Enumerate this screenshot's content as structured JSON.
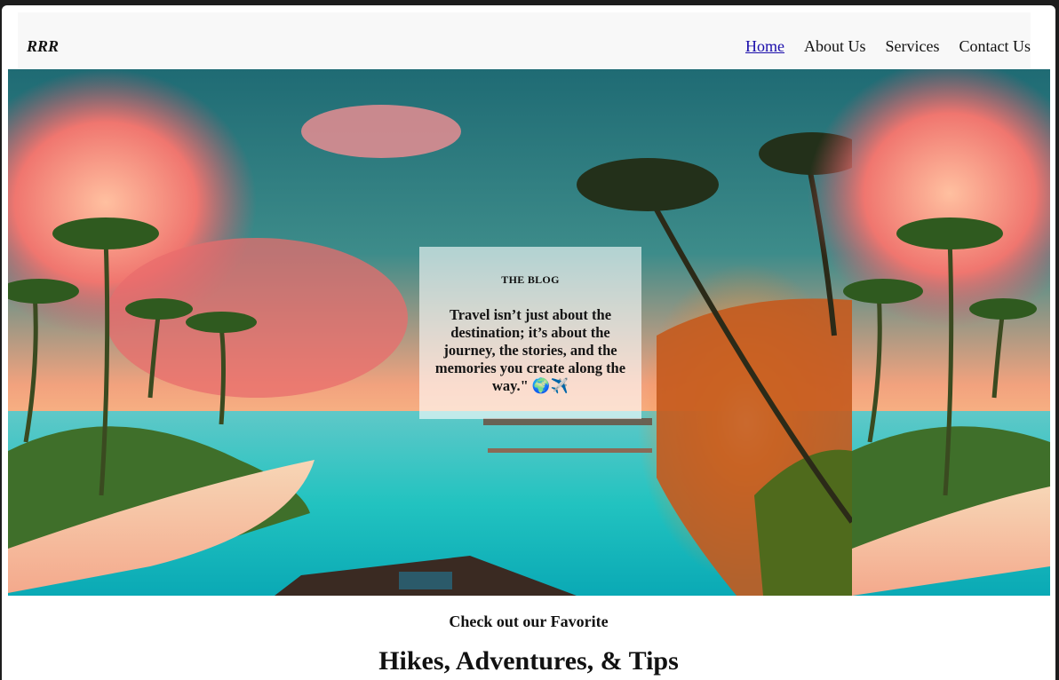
{
  "navbar": {
    "brand": "RRR",
    "links": [
      {
        "label": "Home",
        "active": true
      },
      {
        "label": "About Us",
        "active": false
      },
      {
        "label": "Services",
        "active": false
      },
      {
        "label": "Contact Us",
        "active": false
      }
    ]
  },
  "hero": {
    "blog_label": "THE BLOG",
    "quote": "Travel isn’t just about the destination; it’s about the journey, the stories, and the memories you create along the way.\" 🌍✈️"
  },
  "section": {
    "subheading": "Check out our Favorite",
    "heading": "Hikes, Adventures, & Tips"
  },
  "colors": {
    "link_active": "#1a0dab",
    "nav_bg": "#f8f8f8",
    "card_bg": "rgba(255,255,255,0.62)"
  }
}
